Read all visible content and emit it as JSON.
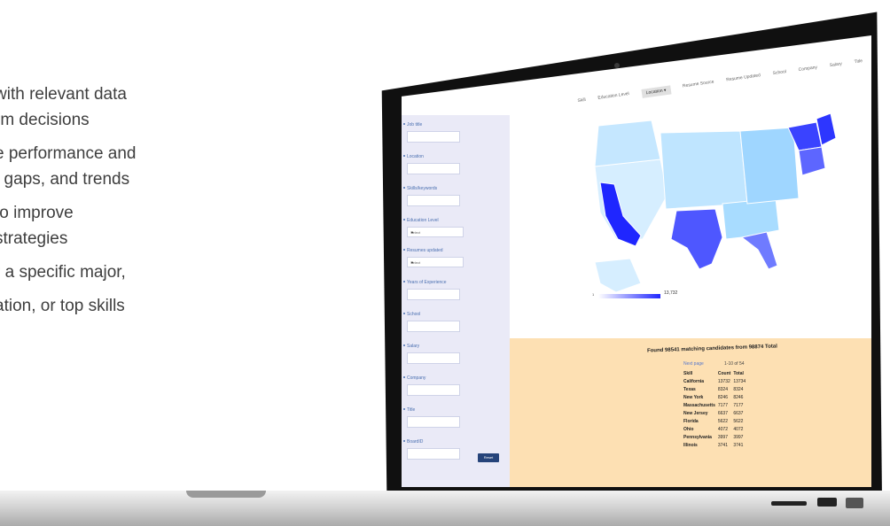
{
  "marketing": {
    "lines": [
      "with relevant data",
      "rm decisions",
      "e performance and",
      ", gaps, and trends",
      "to improve",
      "strategies",
      "r a specific major,",
      "ation, or top skills"
    ]
  },
  "nav": {
    "tabs": [
      "Skill",
      "Education Level",
      "Location ▾",
      "Resume Source",
      "Resume Updated",
      "School",
      "Company",
      "Salary",
      "Title"
    ],
    "active_tab": "Location ▾"
  },
  "sidebar": {
    "fields": [
      {
        "label": "Job title"
      },
      {
        "label": "Location"
      },
      {
        "label": "Skills/keywords"
      },
      {
        "label": "Education Level",
        "value": "Select"
      },
      {
        "label": "Resumes updated",
        "value": "Select"
      },
      {
        "label": "Years of Experience"
      },
      {
        "label": "School"
      },
      {
        "label": "Salary"
      },
      {
        "label": "Company"
      },
      {
        "label": "Title"
      },
      {
        "label": "BoardID"
      }
    ],
    "reset_label": "Reset"
  },
  "map": {
    "legend_min": "1",
    "legend_max": "13,732",
    "low_color": "#dff3ff",
    "high_color": "#1f26ff"
  },
  "results": {
    "title": "Found 98541 matching candidates from 98874 Total",
    "next_page": "Next page",
    "page_info": "1-10 of 54",
    "columns": [
      "Skill",
      "Count",
      "Total"
    ],
    "rows": [
      [
        "California",
        "13732",
        "13734"
      ],
      [
        "Texas",
        "8324",
        "8324"
      ],
      [
        "New York",
        "8246",
        "8246"
      ],
      [
        "Massachusetts",
        "7177",
        "7177"
      ],
      [
        "New Jersey",
        "6637",
        "6637"
      ],
      [
        "Florida",
        "5622",
        "5622"
      ],
      [
        "Ohio",
        "4072",
        "4072"
      ],
      [
        "Pennsylvania",
        "3997",
        "3997"
      ],
      [
        "Illinois",
        "3741",
        "3741"
      ]
    ]
  }
}
